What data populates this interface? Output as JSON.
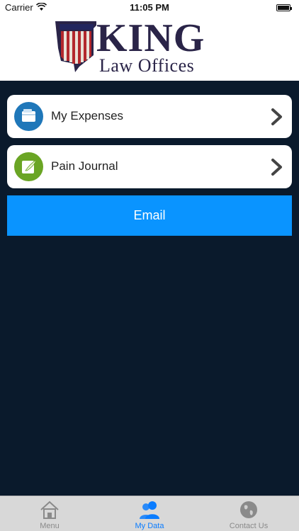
{
  "status_bar": {
    "carrier": "Carrier",
    "time": "11:05 PM"
  },
  "brand": {
    "name": "KING",
    "subtitle": "Law Offices"
  },
  "cards": [
    {
      "label": "My Expenses",
      "icon": "wallet-icon",
      "color": "#1f77b9"
    },
    {
      "label": "Pain Journal",
      "icon": "journal-icon",
      "color": "#6aa524"
    }
  ],
  "email_button": {
    "label": "Email",
    "color": "#0a94ff"
  },
  "tabbar": {
    "tabs": [
      {
        "label": "Menu",
        "icon": "house-icon",
        "active": false
      },
      {
        "label": "My Data",
        "icon": "people-icon",
        "active": true
      },
      {
        "label": "Contact Us",
        "icon": "globe-icon",
        "active": false
      }
    ],
    "active_color": "#0a7cff",
    "inactive_color": "#8a8a8a"
  }
}
